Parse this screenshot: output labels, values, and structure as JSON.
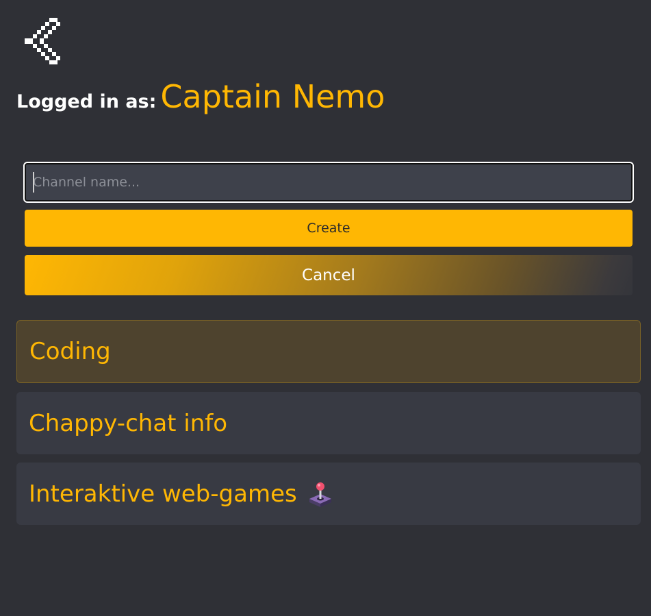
{
  "header": {
    "back_icon": "chevron-left-pixel-icon",
    "logged_in_label": "Logged in as:",
    "username": "Captain Nemo"
  },
  "new_channel_form": {
    "input_placeholder": "Channel name...",
    "input_value": "",
    "create_label": "Create",
    "cancel_label": "Cancel"
  },
  "channels": [
    {
      "name": "Coding",
      "active": true
    },
    {
      "name": "Chappy-chat info",
      "active": false
    },
    {
      "name": "Interaktive web-games",
      "active": false,
      "icon": "joystick-icon"
    }
  ],
  "colors": {
    "background": "#2f3036",
    "accent": "#ffb703",
    "channel_bg": "#383a43",
    "channel_active_bg": "#4e432e",
    "input_bg": "#3e414b"
  }
}
